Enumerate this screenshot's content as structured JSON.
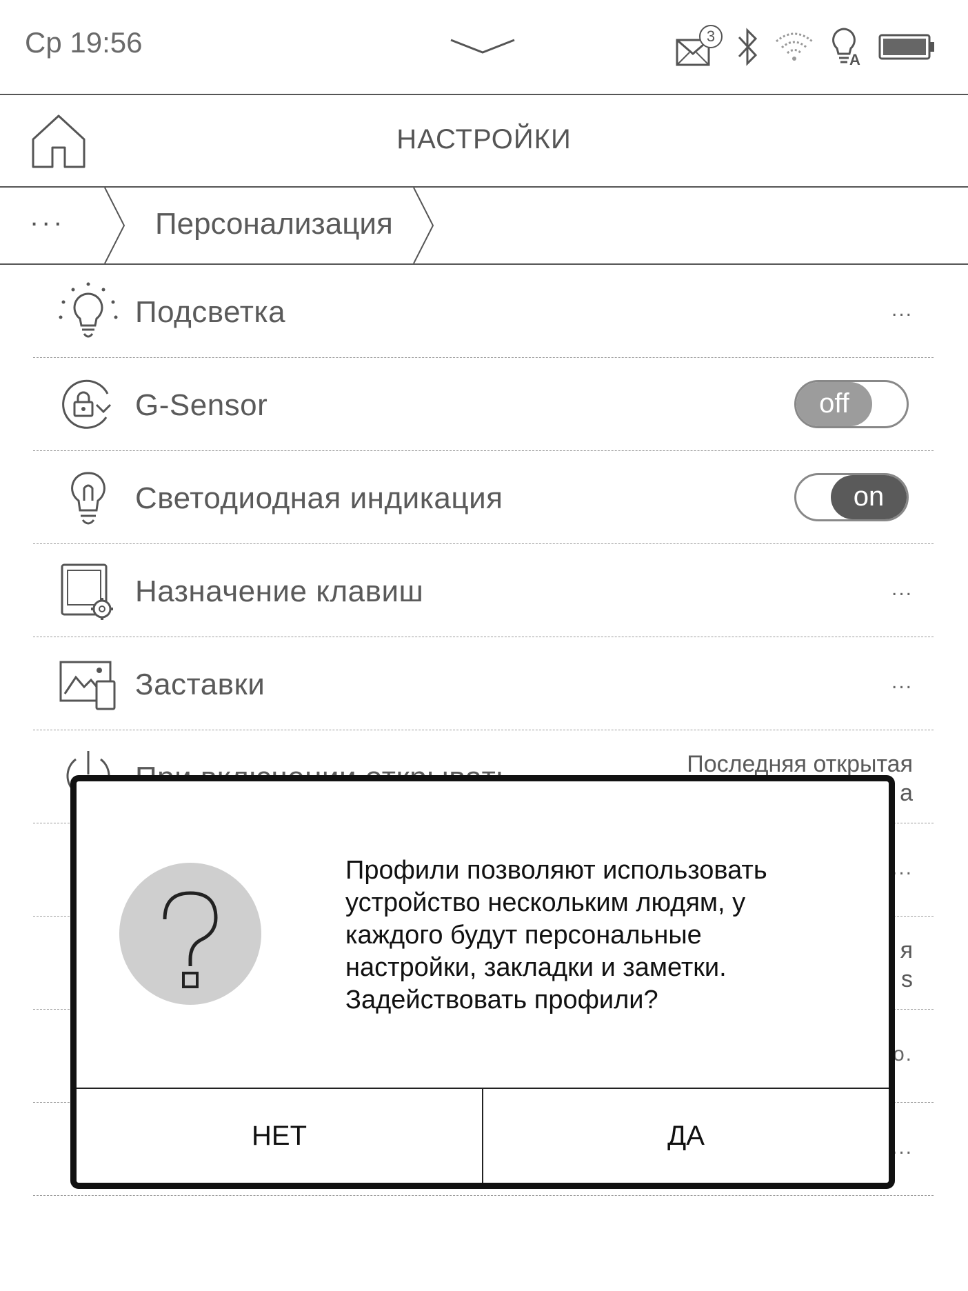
{
  "status_bar": {
    "clock": "Ср 19:56",
    "mail_badge": "3",
    "light_badge": "A",
    "icons": [
      "mail-icon",
      "bluetooth-icon",
      "wifi-icon",
      "frontlight-icon",
      "battery-icon"
    ]
  },
  "header": {
    "title": "НАСТРОЙКИ",
    "home_icon": "home-icon"
  },
  "breadcrumb": {
    "more": "...",
    "current": "Персонализация"
  },
  "settings": {
    "items": [
      {
        "label": "Подсветка",
        "icon": "frontlight-icon",
        "control": "..."
      },
      {
        "label": "G-Sensor",
        "icon": "rotation-lock-icon",
        "control": "off"
      },
      {
        "label": "Светодиодная индикация",
        "icon": "led-bulb-icon",
        "control": "on"
      },
      {
        "label": "Назначение клавиш",
        "icon": "key-mapping-icon",
        "control": "..."
      },
      {
        "label": "Заставки",
        "icon": "screensaver-icon",
        "control": "..."
      },
      {
        "label": "При включении открывать",
        "icon": "power-icon",
        "value_line1": "Последняя открытая",
        "value_line2": "а"
      }
    ],
    "partially_hidden": [
      {
        "value": "..."
      },
      {
        "value_line1": "я",
        "value_line2": "s"
      },
      {
        "value": "о."
      },
      {
        "value": "..."
      }
    ]
  },
  "dialog": {
    "icon": "question-icon",
    "message_lines": [
      "Профили позволяют использовать",
      "устройство нескольким людям, у",
      "каждого будут персональные",
      "настройки, закладки и заметки.",
      "Задействовать профили?"
    ],
    "no_label": "НЕТ",
    "yes_label": "ДА"
  },
  "colors": {
    "text": "#5a5a5a",
    "toggle_off": "#9c9c9c",
    "toggle_on": "#5a5a5a",
    "dialog_border": "#111111",
    "question_circle": "#cfcfcf"
  }
}
